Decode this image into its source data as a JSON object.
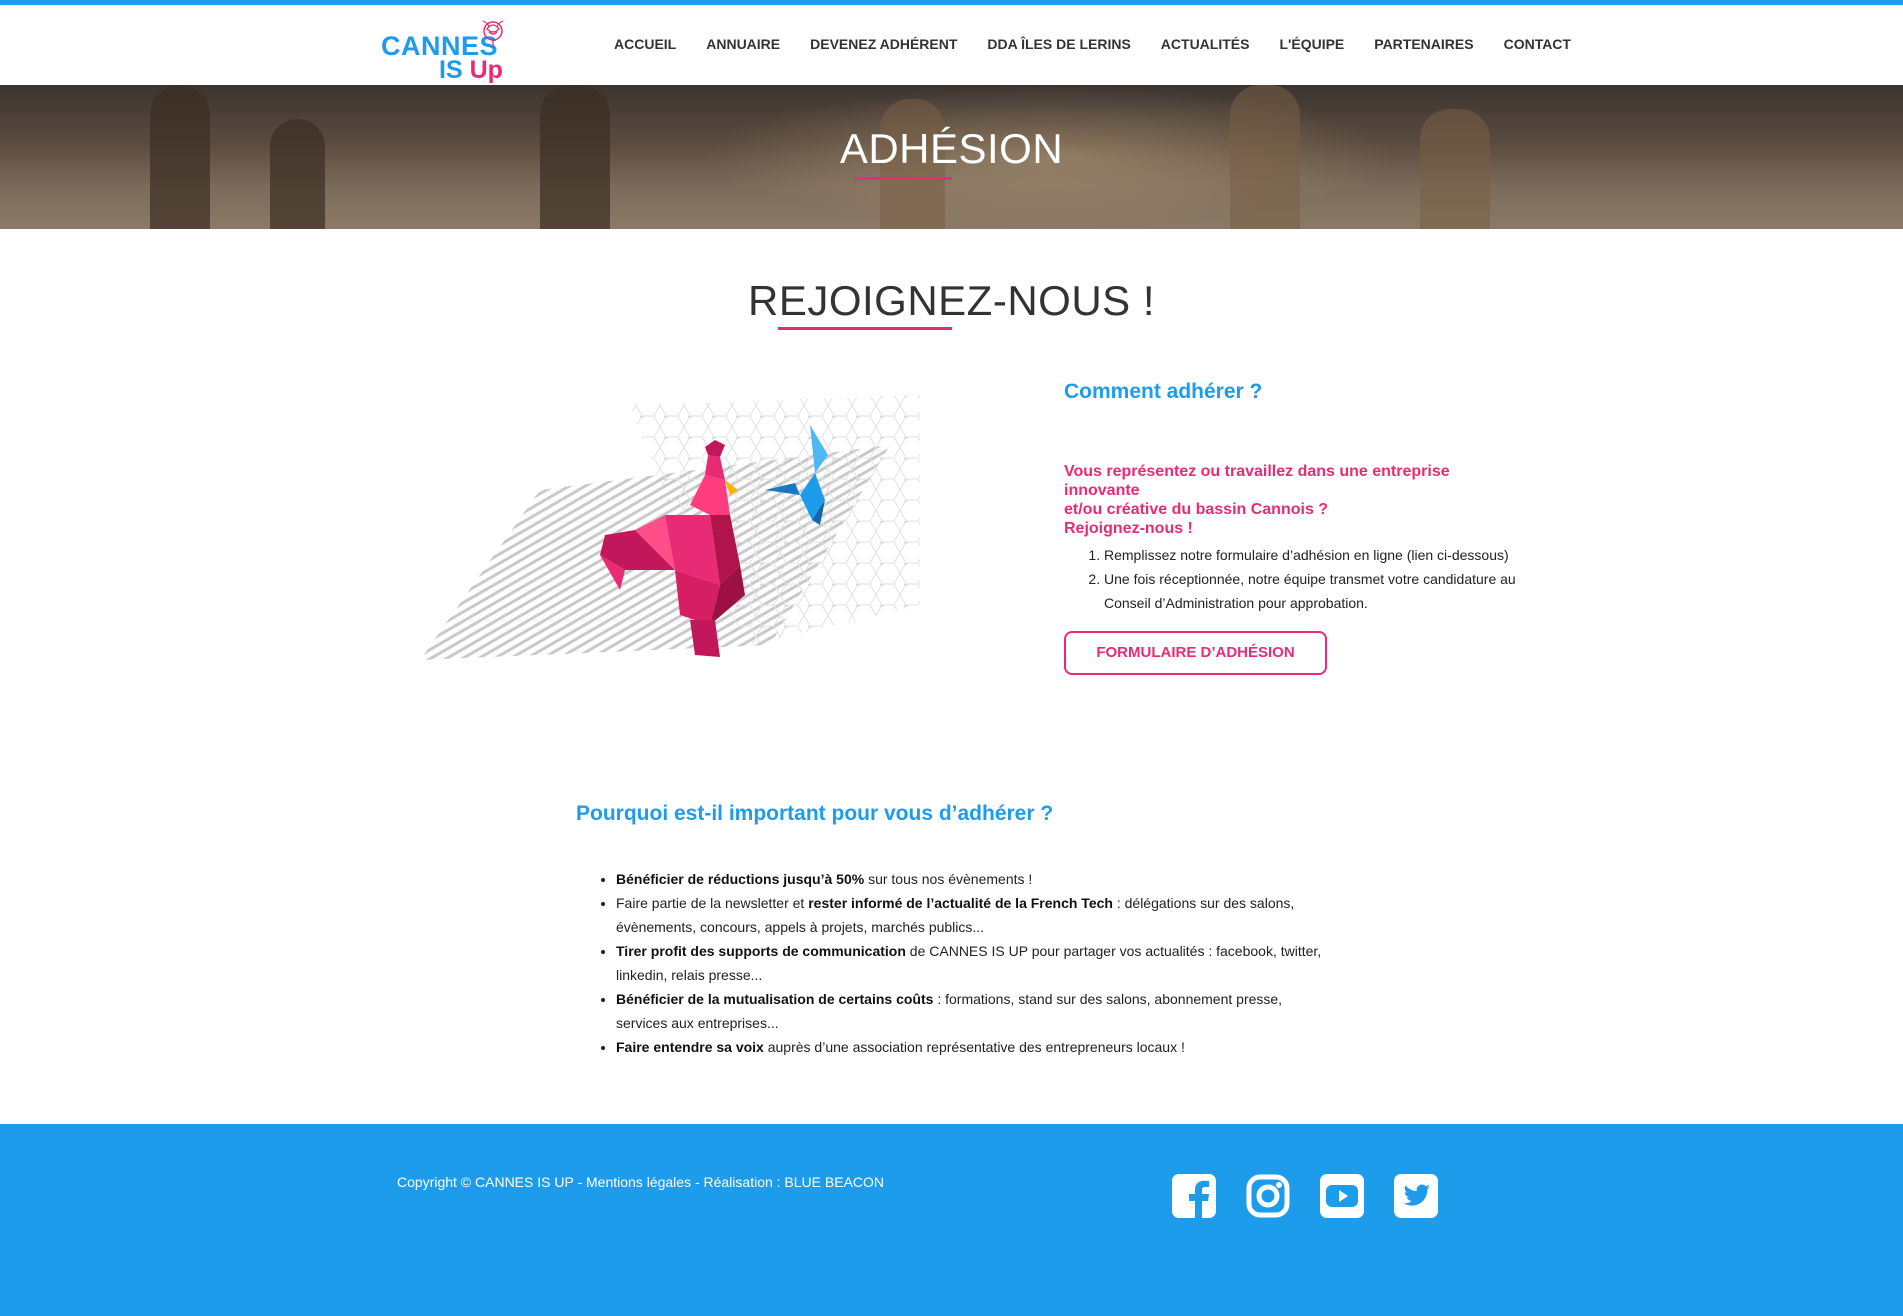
{
  "header": {
    "logo_line1": "CANNES",
    "logo_line2a": "IS ",
    "logo_line2b": "Up",
    "nav": [
      {
        "label": "ACCUEIL"
      },
      {
        "label": "ANNUAIRE"
      },
      {
        "label": "DEVENEZ ADHÉRENT"
      },
      {
        "label": "DDA ÎLES DE LERINS"
      },
      {
        "label": "ACTUALITÉS"
      },
      {
        "label": "L'ÉQUIPE"
      },
      {
        "label": "PARTENAIRES"
      },
      {
        "label": "CONTACT"
      }
    ]
  },
  "hero": {
    "title": "ADHÉSION"
  },
  "section": {
    "title": "REJOIGNEZ-NOUS !"
  },
  "how": {
    "title": "Comment adhérer ?",
    "pink_line1": "Vous représentez ou travaillez dans une entreprise innovante",
    "pink_line2": "et/ou créative du bassin Cannois ?",
    "pink_line3": "Rejoignez-nous !",
    "steps": [
      "Remplissez notre formulaire d’adhésion en ligne (lien ci-dessous)",
      "Une fois réceptionnée, notre équipe transmet votre candidature au Conseil d’Administration pour approbation."
    ],
    "button": "FORMULAIRE D’ADHÉSION"
  },
  "why": {
    "title": "Pourquoi est-il important pour vous d’adhérer ?",
    "items": [
      {
        "bold": "Bénéficier de réductions jusqu’à 50%",
        "text": " sur tous nos évènements !"
      },
      {
        "pre": "Faire partie de la newsletter et ",
        "bold": "rester informé de l’actualité de la French Tech",
        "text": " : délégations sur des salons, évènements, concours, appels à projets, marchés publics..."
      },
      {
        "bold": "Tirer profit des supports de communication",
        "text": " de CANNES IS UP pour partager vos actualités : facebook, twitter, linkedin, relais presse..."
      },
      {
        "bold": "Bénéficier de la mutualisation de certains coûts",
        "text": " : formations, stand sur des salons, abonnement presse, services aux entreprises..."
      },
      {
        "bold": "Faire entendre sa voix",
        "text": " auprès d’une association représentative des entrepreneurs locaux !"
      }
    ]
  },
  "footer": {
    "copyright": "Copyright © CANNES IS UP - Mentions légales - Réalisation : BLUE BEACON",
    "socials": [
      "facebook-icon",
      "instagram-icon",
      "youtube-icon",
      "twitter-icon"
    ]
  },
  "colors": {
    "accent_blue": "#1e9cec",
    "accent_pink": "#e92b75"
  }
}
